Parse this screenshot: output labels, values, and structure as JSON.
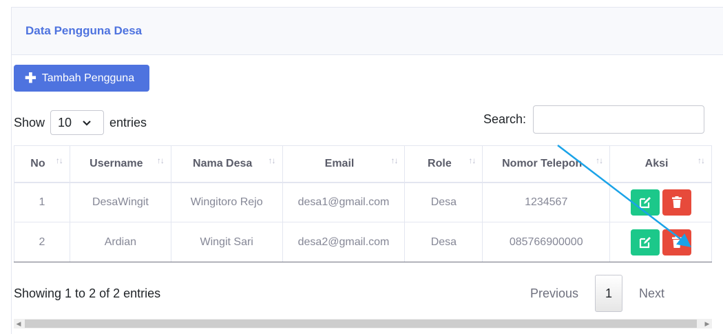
{
  "card": {
    "title": "Data Pengguna Desa"
  },
  "add_button": {
    "icon": "plus-icon",
    "label": "Tambah Pengguna"
  },
  "length": {
    "show": "Show",
    "value": "10",
    "entries": "entries"
  },
  "search": {
    "label": "Search:",
    "value": ""
  },
  "table": {
    "columns": [
      "No",
      "Username",
      "Nama Desa",
      "Email",
      "Role",
      "Nomor Telepon",
      "Aksi"
    ],
    "rows": [
      [
        "1",
        "DesaWingit",
        "Wingitoro Rejo",
        "desa1@gmail.com",
        "Desa",
        "1234567"
      ],
      [
        "2",
        "Ardian",
        "Wingit Sari",
        "desa2@gmail.com",
        "Desa",
        "085766900000"
      ]
    ],
    "sort_icon": "sort-arrows-icon",
    "actions": {
      "edit_icon": "edit-icon",
      "delete_icon": "trash-icon"
    }
  },
  "footer": {
    "info": "Showing 1 to 2 of 2 entries",
    "previous": "Previous",
    "page": "1",
    "next": "Next"
  },
  "colors": {
    "primary": "#4e73df",
    "success": "#1cc88a",
    "danger": "#e74a3b",
    "annotation_arrow": "#1aa3e8"
  }
}
